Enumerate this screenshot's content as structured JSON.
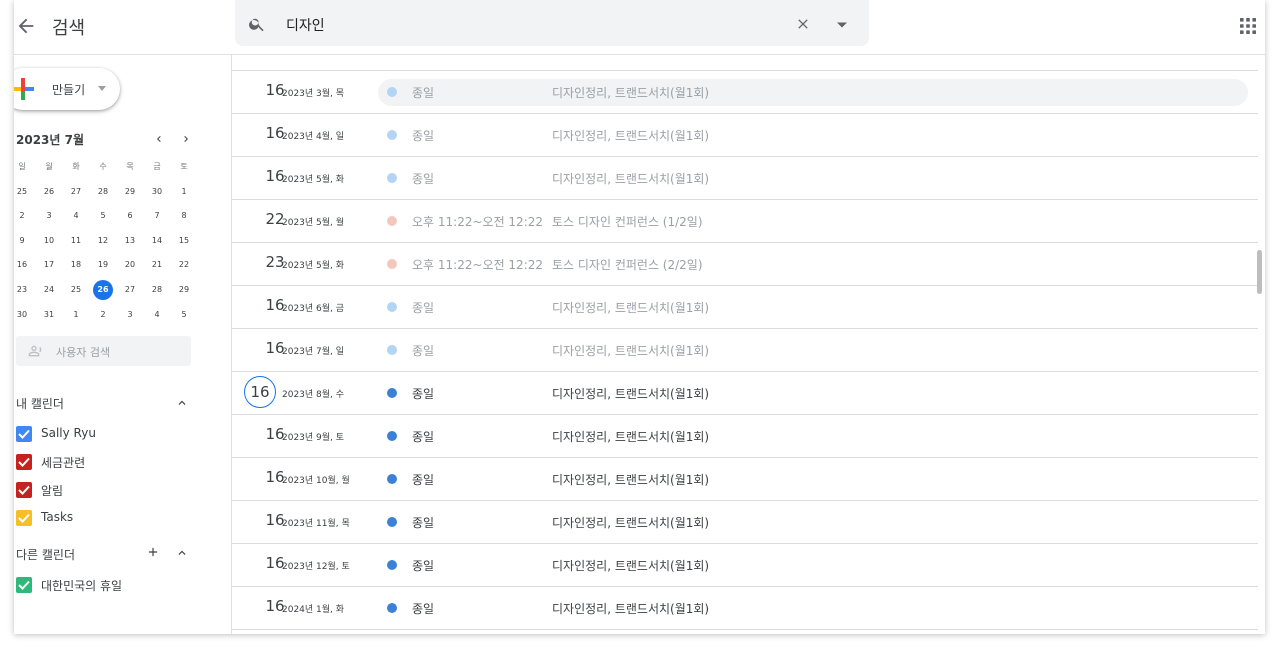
{
  "header": {
    "title": "검색",
    "search_value": "디자인"
  },
  "sidebar": {
    "create_label": "만들기",
    "mini_calendar": {
      "title": "2023년 7월",
      "weekdays": [
        "일",
        "월",
        "화",
        "수",
        "목",
        "금",
        "토"
      ],
      "weeks": [
        [
          "25",
          "26",
          "27",
          "28",
          "29",
          "30",
          "1"
        ],
        [
          "2",
          "3",
          "4",
          "5",
          "6",
          "7",
          "8"
        ],
        [
          "9",
          "10",
          "11",
          "12",
          "13",
          "14",
          "15"
        ],
        [
          "16",
          "17",
          "18",
          "19",
          "20",
          "21",
          "22"
        ],
        [
          "23",
          "24",
          "25",
          "26",
          "27",
          "28",
          "29"
        ],
        [
          "30",
          "31",
          "1",
          "2",
          "3",
          "4",
          "5"
        ]
      ],
      "selected_day": "26"
    },
    "user_search_placeholder": "사용자 검색",
    "my_calendars_title": "내 캘린더",
    "my_calendars": [
      {
        "name": "Sally Ryu",
        "color": "#4285f4"
      },
      {
        "name": "세금관련",
        "color": "#c5221f"
      },
      {
        "name": "알림",
        "color": "#c5221f"
      },
      {
        "name": "Tasks",
        "color": "#f6bf26"
      }
    ],
    "other_calendars_title": "다른 캘린더",
    "other_calendars": [
      {
        "name": "대한민국의 휴일",
        "color": "#33b679"
      }
    ]
  },
  "results": [
    {
      "day": "16",
      "ym": "2023년 3월, 목",
      "time": "종일",
      "title": "디자인정리, 트랜드서치(월1회)",
      "dot": "#b3d4f5",
      "past": true,
      "highlight": true
    },
    {
      "day": "16",
      "ym": "2023년 4월, 일",
      "time": "종일",
      "title": "디자인정리, 트랜드서치(월1회)",
      "dot": "#b3d4f5",
      "past": true
    },
    {
      "day": "16",
      "ym": "2023년 5월, 화",
      "time": "종일",
      "title": "디자인정리, 트랜드서치(월1회)",
      "dot": "#b3d4f5",
      "past": true
    },
    {
      "day": "22",
      "ym": "2023년 5월, 월",
      "time": "오후 11:22~오전 12:22",
      "title": "토스 디자인 컨퍼런스 (1/2일)",
      "dot": "#f4c7bd",
      "past": true
    },
    {
      "day": "23",
      "ym": "2023년 5월, 화",
      "time": "오후 11:22~오전 12:22",
      "title": "토스 디자인 컨퍼런스 (2/2일)",
      "dot": "#f4c7bd",
      "past": true
    },
    {
      "day": "16",
      "ym": "2023년 6월, 금",
      "time": "종일",
      "title": "디자인정리, 트랜드서치(월1회)",
      "dot": "#b3d4f5",
      "past": true
    },
    {
      "day": "16",
      "ym": "2023년 7월, 일",
      "time": "종일",
      "title": "디자인정리, 트랜드서치(월1회)",
      "dot": "#b3d4f5",
      "past": true
    },
    {
      "day": "16",
      "ym": "2023년 8월, 수",
      "time": "종일",
      "title": "디자인정리, 트랜드서치(월1회)",
      "dot": "#3b82d6",
      "circled": true
    },
    {
      "day": "16",
      "ym": "2023년 9월, 토",
      "time": "종일",
      "title": "디자인정리, 트랜드서치(월1회)",
      "dot": "#3b82d6"
    },
    {
      "day": "16",
      "ym": "2023년 10월, 월",
      "time": "종일",
      "title": "디자인정리, 트랜드서치(월1회)",
      "dot": "#3b82d6"
    },
    {
      "day": "16",
      "ym": "2023년 11월, 목",
      "time": "종일",
      "title": "디자인정리, 트랜드서치(월1회)",
      "dot": "#3b82d6"
    },
    {
      "day": "16",
      "ym": "2023년 12월, 토",
      "time": "종일",
      "title": "디자인정리, 트랜드서치(월1회)",
      "dot": "#3b82d6"
    },
    {
      "day": "16",
      "ym": "2024년 1월, 화",
      "time": "종일",
      "title": "디자인정리, 트랜드서치(월1회)",
      "dot": "#3b82d6"
    }
  ]
}
